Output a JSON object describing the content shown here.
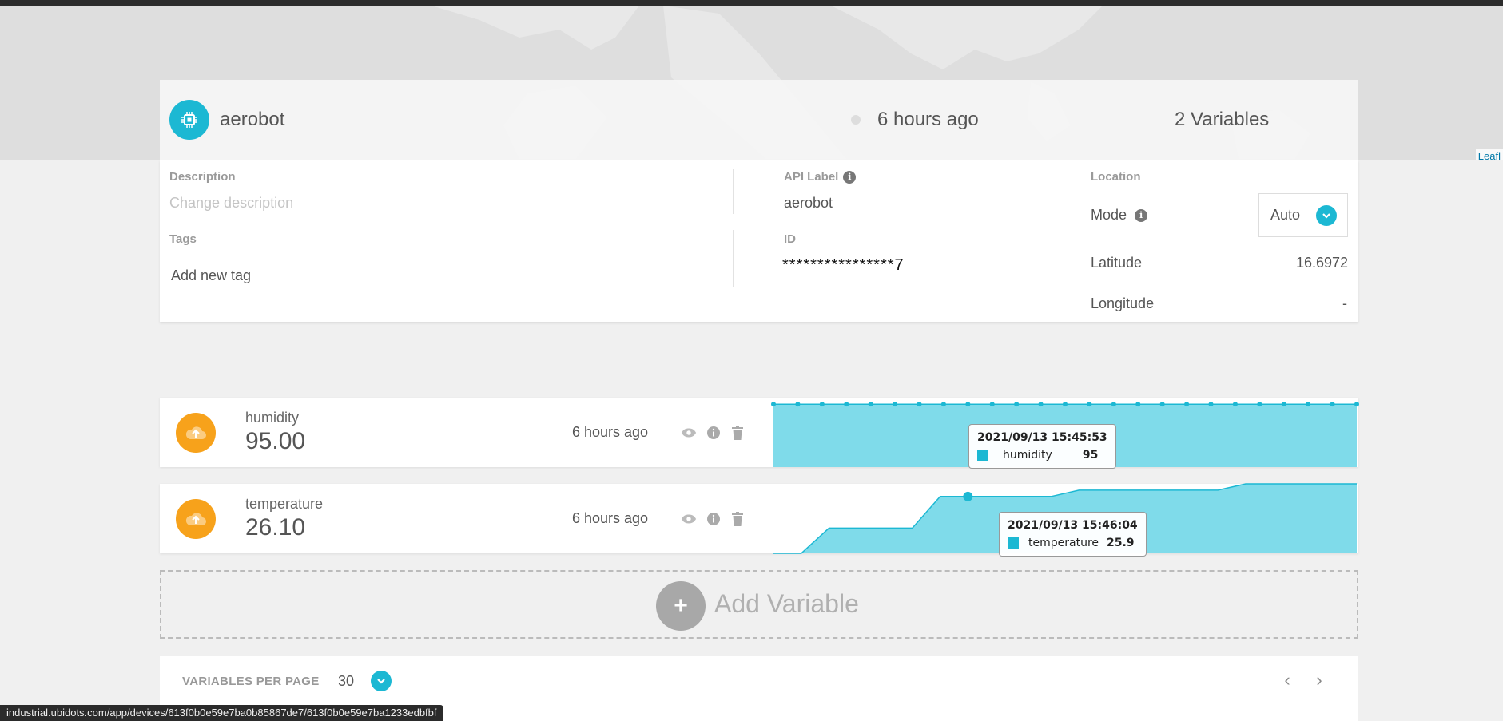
{
  "device": {
    "name": "aerobot",
    "last_activity": "6 hours ago",
    "variable_count": "2 Variables"
  },
  "map": {
    "attribution": "Leafl"
  },
  "details": {
    "description_label": "Description",
    "description_placeholder": "Change description",
    "tags_label": "Tags",
    "tags_placeholder": "Add new tag",
    "api_label_label": "API Label",
    "api_label_value": "aerobot",
    "id_label": "ID",
    "id_value": "****************7",
    "location_label": "Location",
    "mode_label": "Mode",
    "mode_value": "Auto",
    "latitude_label": "Latitude",
    "latitude_value": "16.6972",
    "longitude_label": "Longitude",
    "longitude_value": "-"
  },
  "variables": [
    {
      "name": "humidity",
      "value": "95.00",
      "last_update": "6 hours ago",
      "chart": {
        "type": "area",
        "values": [
          95,
          95,
          95,
          95,
          95,
          95,
          95,
          95,
          95,
          95,
          95,
          95,
          95,
          95,
          95,
          95,
          95,
          95,
          95,
          95,
          95,
          95,
          95,
          95,
          95
        ],
        "ylim": [
          0,
          100
        ]
      },
      "tooltip": {
        "date": "2021/09/13 15:45:53",
        "series": "humidity",
        "value": "95"
      }
    },
    {
      "name": "temperature",
      "value": "26.10",
      "last_update": "6 hours ago",
      "chart": {
        "type": "area",
        "values": [
          25.0,
          25.0,
          25.4,
          25.4,
          25.4,
          25.4,
          25.9,
          25.9,
          25.9,
          25.9,
          25.9,
          26.0,
          26.0,
          26.0,
          26.0,
          26.0,
          26.0,
          26.1,
          26.1,
          26.1,
          26.1,
          26.1
        ],
        "ylim": [
          25.0,
          26.1
        ]
      },
      "tooltip": {
        "date": "2021/09/13 15:46:04",
        "series": "temperature",
        "value": "25.9"
      }
    }
  ],
  "add_variable": {
    "label": "Add Variable"
  },
  "pagination": {
    "per_page_label": "VARIABLES PER PAGE",
    "per_page_value": "30",
    "prev": "‹",
    "next": "›"
  },
  "status_url": "industrial.ubidots.com/app/devices/613f0b0e59e7ba0b85867de7/613f0b0e59e7ba1233edbfbf",
  "colors": {
    "accent": "#1cb8d3",
    "variable_icon": "#f7a21b",
    "chart_fill": "#7fdbea"
  },
  "icons": {
    "device": "chip-icon",
    "variable": "cloud-upload-icon",
    "actions": [
      "eye-icon",
      "info-icon",
      "trash-icon"
    ]
  }
}
